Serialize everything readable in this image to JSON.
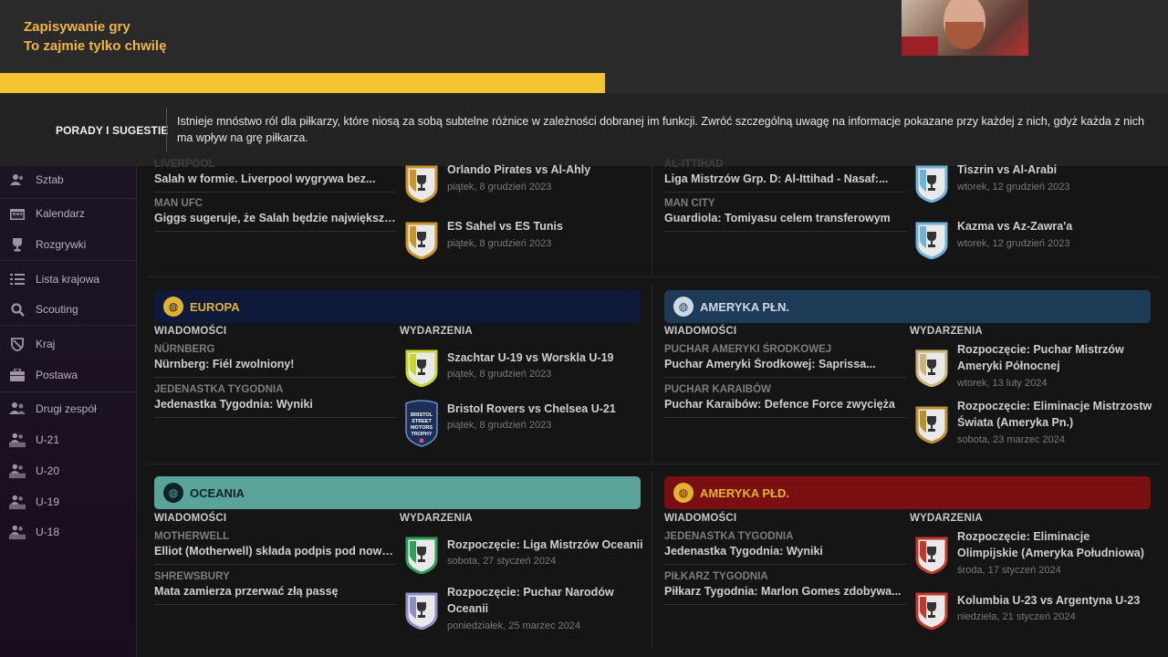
{
  "save": {
    "title": "Zapisywanie gry",
    "subtitle": "To zajmie tylko chwilę",
    "progress_fraction": 0.518
  },
  "tips": {
    "label": "PORADY I SUGESTIE",
    "text": "Istnieje mnóstwo ról dla piłkarzy, które niosą za sobą subtelne różnice w zależności dobranej im funkcji. Zwróć szczególną uwagę na informacje pokazane przy każdej z nich, gdyż każda z nich ma wpływ na grę piłkarza."
  },
  "sidebar": {
    "items": [
      {
        "label": "Sztab",
        "icon": "staff-icon"
      },
      {
        "label": "Kalendarz",
        "icon": "calendar-icon"
      },
      {
        "label": "Rozgrywki",
        "icon": "trophy-icon"
      },
      {
        "label": "Lista krajowa",
        "icon": "list-icon"
      },
      {
        "label": "Scouting",
        "icon": "magnifier-icon"
      },
      {
        "label": "Kraj",
        "icon": "shield-icon"
      },
      {
        "label": "Postawa",
        "icon": "briefcase-icon"
      },
      {
        "label": "Drugi zespół",
        "icon": "team-icon"
      },
      {
        "label": "U-21",
        "icon": "team-u21-icon"
      },
      {
        "label": "U-20",
        "icon": "team-u20-icon"
      },
      {
        "label": "U-19",
        "icon": "team-u19-icon"
      },
      {
        "label": "U-18",
        "icon": "team-u18-icon"
      }
    ]
  },
  "colors": {
    "europe": "#0f1a3a",
    "north_america": "#1d3a57",
    "oceania": "#5aa39a",
    "south_america": "#7a0f12",
    "europe_text": "#e0b331",
    "north_america_text": "#cfd9e3",
    "oceania_text": "#0d2327",
    "south_america_text": "#e0b331",
    "progress": "#f4c430"
  },
  "top": {
    "left_news": [
      {
        "kicker": "LIVERPOOL",
        "headline": "Salah w formie. Liverpool wygrywa bez..."
      },
      {
        "kicker": "MAN UFC",
        "headline": "Giggs sugeruje, że Salah będzie największy..."
      }
    ],
    "left_events": [
      {
        "title": "Orlando Pirates vs Al-Ahly",
        "date": "piątek, 8 grudzień 2023",
        "badge_color": "#c9952b"
      },
      {
        "title": "ES Sahel vs ES Tunis",
        "date": "piątek, 8 grudzień 2023",
        "badge_color": "#c9952b"
      }
    ],
    "right_news": [
      {
        "kicker": "AL-ITTIHAD",
        "headline": "Liga Mistrzów Grp. D: Al-Ittihad - Nasaf:..."
      },
      {
        "kicker": "MAN CITY",
        "headline": "Guardiola: Tomiyasu celem transferowym"
      }
    ],
    "right_events": [
      {
        "title": "Tiszrin vs Al-Arabi",
        "date": "wtorek, 12 grudzień 2023",
        "badge_color": "#6fb4d8"
      },
      {
        "title": "Kazma vs Az-Zawra'a",
        "date": "wtorek, 12 grudzień 2023",
        "badge_color": "#6fb4d8"
      }
    ]
  },
  "labels": {
    "news": "WIADOMOŚCI",
    "events": "WYDARZENIA"
  },
  "europe": {
    "title": "EUROPA",
    "news": [
      {
        "kicker": "NÜRNBERG",
        "headline": "Nürnberg: Fiél zwolniony!"
      },
      {
        "kicker": "JEDENASTKA TYGODNIA",
        "headline": "Jedenastka Tygodnia: Wyniki"
      }
    ],
    "events": [
      {
        "title": "Szachtar U-19 vs Worskla U-19",
        "date": "piątek, 8 grudzień 2023",
        "badge_color": "#c8d632"
      },
      {
        "title": "Bristol Rovers vs Chelsea U-21",
        "date": "piątek, 8 grudzień 2023",
        "badge_color": "#3b6fb3"
      }
    ],
    "badge_text": [
      "BRISTOL",
      "STREET",
      "MOTORS",
      "TROPHY"
    ]
  },
  "north_america": {
    "title": "AMERYKA PŁN.",
    "news": [
      {
        "kicker": "PUCHAR AMERYKI ŚRODKOWEJ",
        "headline": "Puchar Ameryki Środkowej: Saprissa..."
      },
      {
        "kicker": "PUCHAR KARAIBÓW",
        "headline": "Puchar Karaibów: Defence Force zwycięża"
      }
    ],
    "events": [
      {
        "title": "Rozpoczęcie: Puchar Mistrzów Ameryki Północnej",
        "date": "wtorek, 13 luty 2024",
        "badge_color": "#c9b47a"
      },
      {
        "title": "Rozpoczęcie: Eliminacje Mistrzostw Świata (Ameryka Pn.)",
        "date": "sobota, 23 marzec 2024",
        "badge_color": "#b8902f"
      }
    ]
  },
  "oceania": {
    "title": "OCEANIA",
    "news": [
      {
        "kicker": "MOTHERWELL",
        "headline": "Elliot (Motherwell) składa podpis pod nową..."
      },
      {
        "kicker": "SHREWSBURY",
        "headline": "Mata zamierza przerwać złą passę"
      }
    ],
    "events": [
      {
        "title": "Rozpoczęcie: Liga Mistrzów Oceanii",
        "date": "sobota, 27 styczeń 2024",
        "badge_color": "#2f9e5a"
      },
      {
        "title": "Rozpoczęcie: Puchar Narodów Oceanii",
        "date": "poniedziałek, 25 marzec 2024",
        "badge_color": "#8e8ec8"
      }
    ]
  },
  "south_america": {
    "title": "AMERYKA PŁD.",
    "news": [
      {
        "kicker": "JEDENASTKA TYGODNIA",
        "headline": "Jedenastka Tygodnia: Wyniki"
      },
      {
        "kicker": "PIŁKARZ TYGODNIA",
        "headline": "Piłkarz Tygodnia: Marlon Gomes zdobywa..."
      }
    ],
    "events": [
      {
        "title": "Rozpoczęcie: Eliminacje Olimpijskie (Ameryka Południowa)",
        "date": "środa, 17 styczeń 2024",
        "badge_color": "#c0392b"
      },
      {
        "title": "Kolumbia U-23 vs Argentyna U-23",
        "date": "niedziela, 21 styczeń 2024",
        "badge_color": "#c0392b"
      }
    ]
  }
}
